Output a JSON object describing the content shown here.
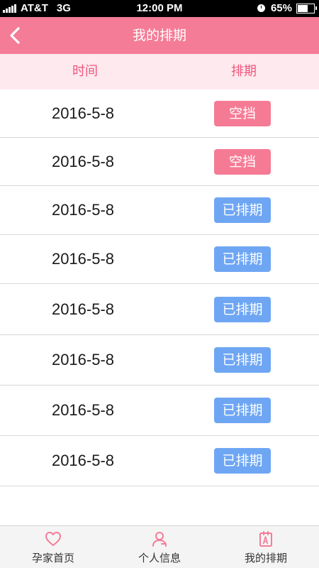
{
  "status_bar": {
    "carrier": "AT&T",
    "network": "3G",
    "time": "12:00 PM",
    "battery": "65%",
    "battery_level": 0.65
  },
  "nav": {
    "title": "我的排期",
    "back_icon": "chevron-left-icon"
  },
  "table": {
    "headers": {
      "time": "时间",
      "schedule": "排期"
    },
    "rows": [
      {
        "date": "2016-5-8",
        "status": "空挡",
        "type": "empty"
      },
      {
        "date": "2016-5-8",
        "status": "空挡",
        "type": "empty"
      },
      {
        "date": "2016-5-8",
        "status": "已排期",
        "type": "booked"
      },
      {
        "date": "2016-5-8",
        "status": "已排期",
        "type": "booked"
      },
      {
        "date": "2016-5-8",
        "status": "已排期",
        "type": "booked"
      },
      {
        "date": "2016-5-8",
        "status": "已排期",
        "type": "booked"
      },
      {
        "date": "2016-5-8",
        "status": "已排期",
        "type": "booked"
      },
      {
        "date": "2016-5-8",
        "status": "已排期",
        "type": "booked"
      }
    ]
  },
  "tabbar": {
    "items": [
      {
        "label": "孕家首页",
        "icon": "heart-icon"
      },
      {
        "label": "个人信息",
        "icon": "user-icon"
      },
      {
        "label": "我的排期",
        "icon": "schedule-icon"
      }
    ]
  },
  "colors": {
    "brand_pink": "#f47c96",
    "header_bg": "#fde9ee",
    "header_text": "#f0577c",
    "badge_empty": "#f57b95",
    "badge_booked": "#6ea6f4"
  }
}
